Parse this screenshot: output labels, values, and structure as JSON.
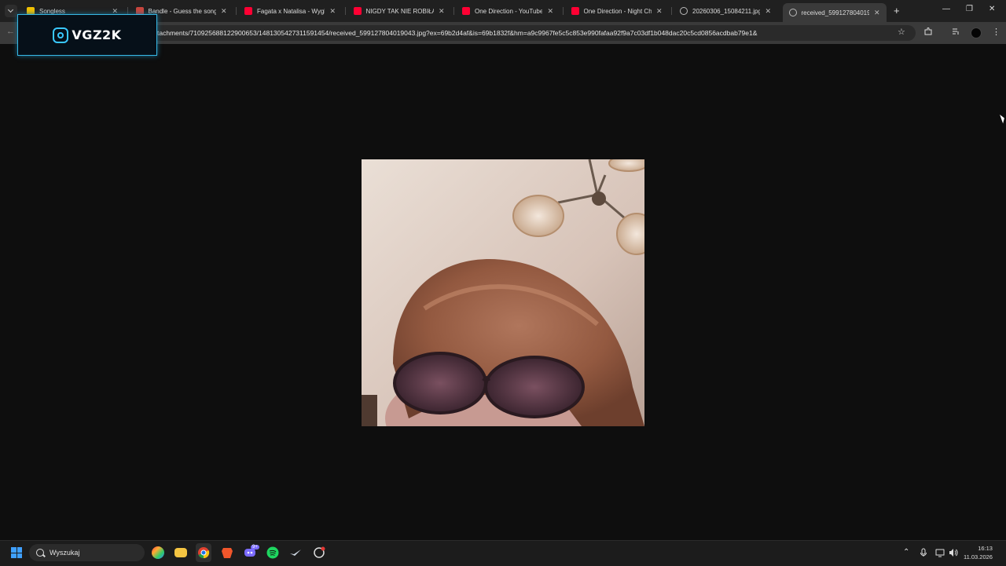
{
  "browser": {
    "tabs": [
      {
        "title": "Songless",
        "favicon": "songless-icon",
        "active": false
      },
      {
        "title": "Bandle - Guess the song.",
        "favicon": "bandle-icon",
        "active": false
      },
      {
        "title": "Fagata x Natalisa - Wygląda",
        "favicon": "youtube-icon",
        "active": false
      },
      {
        "title": "NIGDY TAK NIE ROBIŁAM",
        "favicon": "youtube-icon",
        "active": false
      },
      {
        "title": "One Direction - YouTube",
        "favicon": "youtube-icon",
        "active": false
      },
      {
        "title": "One Direction - Night Ch",
        "favicon": "youtube-icon",
        "active": false
      },
      {
        "title": "20260306_15084211.jpg",
        "favicon": "globe-icon",
        "active": false
      },
      {
        "title": "received_59912780401904",
        "favicon": "globe-icon",
        "active": true
      }
    ],
    "new_tab_label": "+",
    "url": "tachments/710925688122900653/1481305427311591454/received_599127804019043.jpg?ex=69b2d4af&is=69b1832f&hm=a9c9967fe5c5c853e990fafaa92f9a7c03df1b048dac20c5cd0856acdbab79e1&"
  },
  "overlay": {
    "logo_text": "VGZ2K"
  },
  "taskbar": {
    "search_placeholder": "Wyszukaj",
    "discord_badge": "9+",
    "time": "16:13",
    "date": "11.03.2026"
  },
  "colors": {
    "accent_blue": "#3fa0ff",
    "youtube_red": "#ff0033",
    "logo_glow": "#37b9e6"
  }
}
